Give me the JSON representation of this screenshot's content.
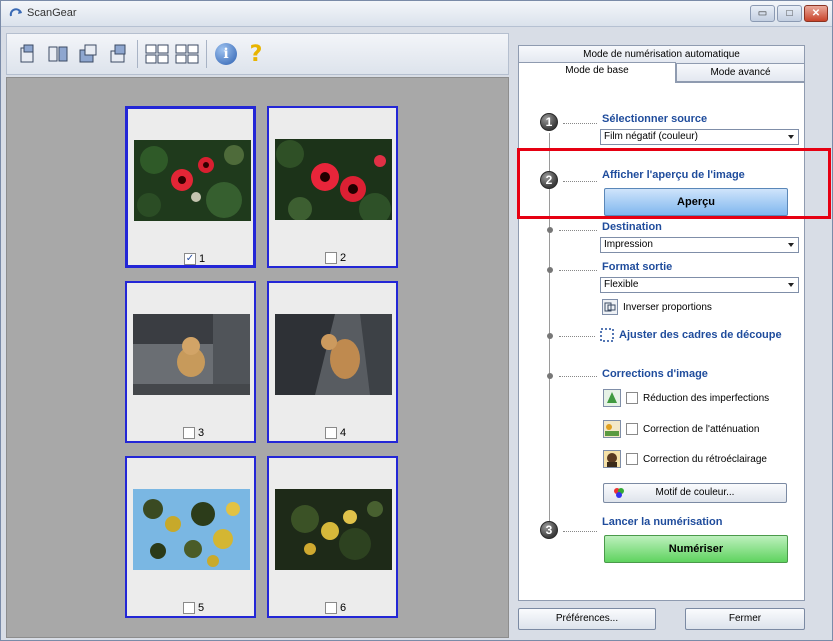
{
  "window": {
    "title": "ScanGear",
    "controls": {
      "minimize": "▭",
      "maximize": "□",
      "close": "✕"
    }
  },
  "toolbar": {
    "icons": [
      "rotate-left-icon",
      "mirror-icon",
      "rotate-right-icon",
      "rotate-180-icon",
      "thumbnail-view-icon",
      "grid-view-icon",
      "info-icon",
      "help-icon"
    ],
    "info_glyph": "i",
    "help_glyph": "?"
  },
  "frames": [
    {
      "label": "1",
      "checked": true,
      "check_glyph": "✓"
    },
    {
      "label": "2",
      "checked": false
    },
    {
      "label": "3",
      "checked": false
    },
    {
      "label": "4",
      "checked": false
    },
    {
      "label": "5",
      "checked": false
    },
    {
      "label": "6",
      "checked": false
    }
  ],
  "tabs": {
    "auto": "Mode de numérisation automatique",
    "basic": "Mode de base",
    "advanced": "Mode avancé"
  },
  "steps": {
    "one": "1",
    "two": "2",
    "three": "3"
  },
  "source": {
    "heading": "Sélectionner source",
    "value": "Film négatif (couleur)"
  },
  "preview": {
    "heading": "Afficher l'aperçu de l'image",
    "button": "Aperçu"
  },
  "destination": {
    "heading": "Destination",
    "value": "Impression"
  },
  "output": {
    "heading": "Format sortie",
    "value": "Flexible",
    "swap_label": "Inverser proportions"
  },
  "crop": {
    "label": "Ajuster des cadres de découpe"
  },
  "corrections": {
    "heading": "Corrections d'image",
    "options": [
      {
        "label": "Réduction des imperfections",
        "checked": false
      },
      {
        "label": "Correction de l'atténuation",
        "checked": false
      },
      {
        "label": "Correction du rétroéclairage",
        "checked": false
      }
    ],
    "color_pattern_button": "Motif de couleur..."
  },
  "scan": {
    "heading": "Lancer la numérisation",
    "button": "Numériser"
  },
  "footer": {
    "preferences": "Préférences...",
    "close": "Fermer"
  },
  "colors": {
    "frame_border": "#2326d6",
    "highlight": "#e60012",
    "heading": "#1f4c9c"
  }
}
